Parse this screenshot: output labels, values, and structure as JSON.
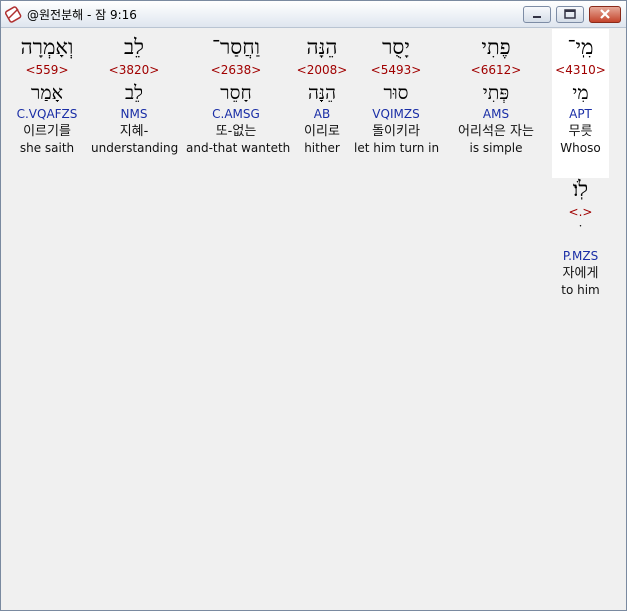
{
  "window": {
    "title": "@원전분해 - 잠 9:16"
  },
  "columns": [
    {
      "hebrew": "מִֽי־",
      "strong": "<4310>",
      "lemma": "מִי",
      "morph": "APT",
      "korean": "무릇",
      "english": "Whoso"
    },
    {
      "hebrew": "פֶתִי",
      "strong": "<6612>",
      "lemma": "פְּתִי",
      "morph": "AMS",
      "korean": "어리석은 자는",
      "english": "is simple"
    },
    {
      "hebrew": "יָסֻר",
      "strong": "<5493>",
      "lemma": "סוּר",
      "morph": "VQIMZS",
      "korean": "돌이키라",
      "english": "let him turn in"
    },
    {
      "hebrew": "הֵנָּה",
      "strong": "<2008>",
      "lemma": "הֵנָּה",
      "morph": "AB",
      "korean": "이리로",
      "english": "hither"
    },
    {
      "hebrew": "וַחֲסַר־",
      "strong": "<2638>",
      "lemma": "חָסֵר",
      "morph": "C.AMSG",
      "korean": "또-없는",
      "english": "and-that wanteth"
    },
    {
      "hebrew": "לֵב",
      "strong": "<3820>",
      "lemma": "לֵב",
      "morph": "NMS",
      "korean": "지혜-",
      "english": "understanding"
    },
    {
      "hebrew": "וְאָמְרָה",
      "strong": "<559>",
      "lemma": "אָמַר",
      "morph": "C.VQAFZS",
      "korean": "이르기를",
      "english": "she saith"
    }
  ],
  "extra": {
    "hebrew": "לֹֽו׃",
    "strong": "<.>",
    "lemma": "ׄ",
    "morph": "P.MZS",
    "korean": "자에게",
    "english": "to him"
  }
}
